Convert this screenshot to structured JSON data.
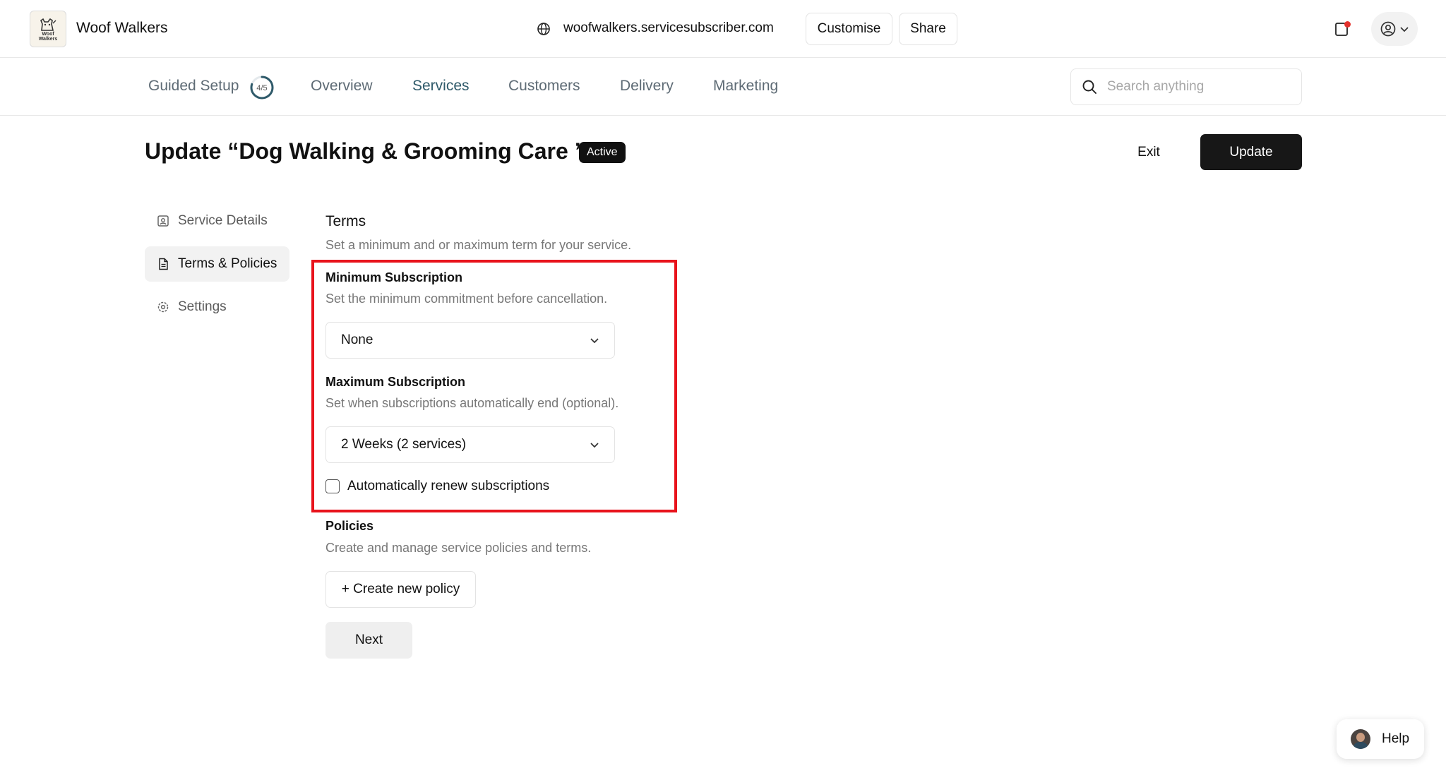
{
  "topbar": {
    "brand": "Woof Walkers",
    "logo_text": "Woof\nWalkers",
    "domain": "woofwalkers.servicesubscriber.com",
    "customise_label": "Customise",
    "share_label": "Share"
  },
  "nav": {
    "guided_setup": "Guided Setup",
    "guided_progress": "4/5",
    "guided_fraction": 0.8,
    "items": [
      "Overview",
      "Services",
      "Customers",
      "Delivery",
      "Marketing"
    ],
    "active": "Services",
    "search_placeholder": "Search anything"
  },
  "header": {
    "title": "Update “Dog Walking & Grooming Care ”",
    "badge": "Active",
    "exit_label": "Exit",
    "update_label": "Update"
  },
  "sidebar": {
    "items": [
      {
        "label": "Service Details",
        "icon": "user-square-icon"
      },
      {
        "label": "Terms & Policies",
        "icon": "document-icon"
      },
      {
        "label": "Settings",
        "icon": "gear-icon"
      }
    ],
    "active": "Terms & Policies"
  },
  "terms": {
    "title": "Terms",
    "subtitle": "Set a minimum and or maximum term for your service.",
    "min_label": "Minimum Subscription",
    "min_help": "Set the minimum commitment before cancellation.",
    "min_value": "None",
    "max_label": "Maximum Subscription",
    "max_help": "Set when subscriptions automatically end (optional).",
    "max_value": "2 Weeks (2 services)",
    "renew_label": "Automatically renew subscriptions",
    "renew_checked": false
  },
  "policies": {
    "title": "Policies",
    "subtitle": "Create and manage service policies and terms.",
    "create_label": "+ Create new policy"
  },
  "footer": {
    "next_label": "Next",
    "help_label": "Help"
  },
  "colors": {
    "highlight": "#e8131c",
    "primary_button": "#171717",
    "active_nav": "#2f5a6a",
    "notification_dot": "#e5322d"
  }
}
